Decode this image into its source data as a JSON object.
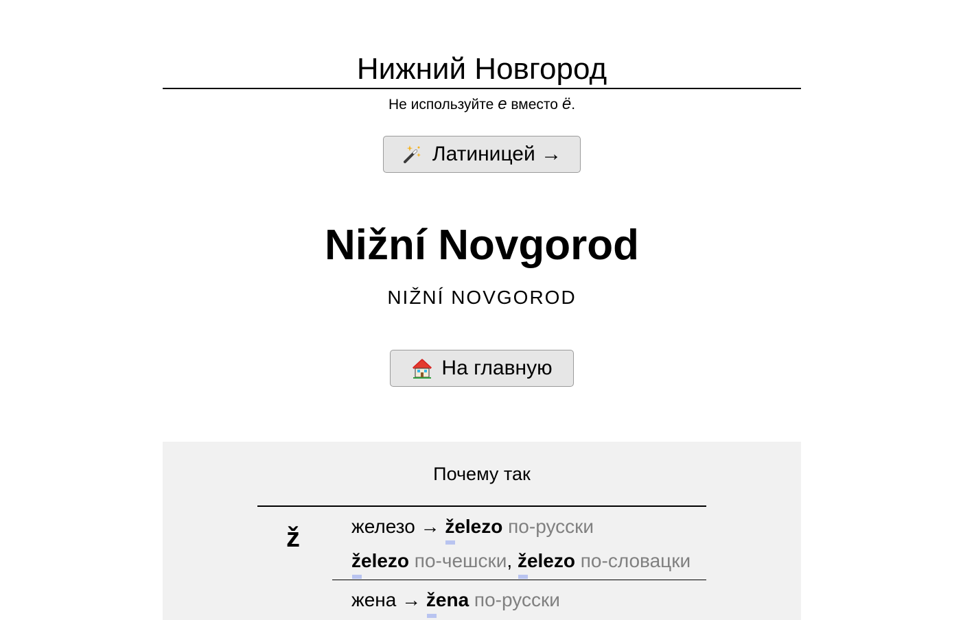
{
  "header": {
    "city_input_value": "Нижний Новгород",
    "hint_prefix": "Не используйте ",
    "hint_e": "е",
    "hint_middle": " вместо ",
    "hint_yo": "ё",
    "hint_suffix": "."
  },
  "buttons": {
    "latin_label": "Латиницей →",
    "latin_icon": "magic-wand-icon",
    "home_label": "На главную",
    "home_icon": "house-icon"
  },
  "result": {
    "latin": "Nižní Novgorod",
    "latin_caps": "NIŽNÍ NOVGOROD"
  },
  "why": {
    "title": "Почему так",
    "letter": "ž",
    "examples": [
      {
        "source": "железо",
        "arrow": " → ",
        "latin": "železo",
        "lang": " по-русски"
      },
      {
        "latin1": "železo",
        "lang1": " по-чешски",
        "comma": ", ",
        "latin2": "železo",
        "lang2": " по-словацки"
      },
      {
        "source": "жена",
        "arrow": " → ",
        "latin": "žena",
        "lang": " по-русски"
      }
    ]
  },
  "colors": {
    "button_bg": "#e6e6e6",
    "panel_bg": "#f1f1f1",
    "muted_text": "#808080",
    "highlight": "#b9c4f0"
  }
}
